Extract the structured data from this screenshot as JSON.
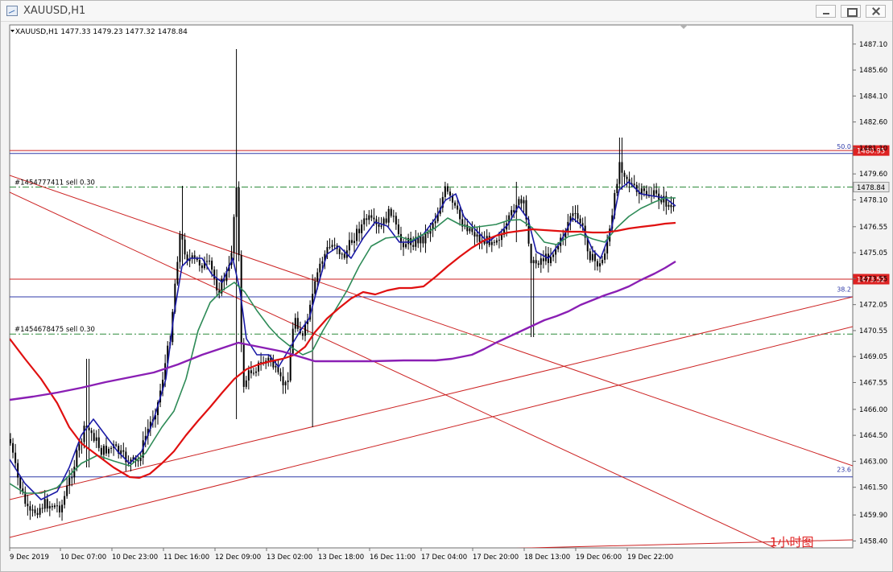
{
  "window": {
    "title": "XAUUSD,H1"
  },
  "chart_header": {
    "symbol_line": "XAUUSD,H1  1477.33 1479.23 1477.32 1478.84"
  },
  "chart_data": {
    "type": "candlestick",
    "symbol": "XAUUSD",
    "timeframe": "H1",
    "ohlc": [
      1477.33,
      1479.23,
      1477.32,
      1478.84
    ],
    "y_ticks": [
      "1487.10",
      "1485.60",
      "1484.10",
      "1482.60",
      "1481.10",
      "1479.60",
      "1478.10",
      "1476.55",
      "1475.05",
      "1473.55",
      "1472.05",
      "1470.55",
      "1469.05",
      "1467.55",
      "1466.00",
      "1464.50",
      "1463.00",
      "1461.50",
      "1459.90",
      "1458.40"
    ],
    "y_tick_values": [
      1487.1,
      1485.6,
      1484.1,
      1482.6,
      1481.1,
      1479.6,
      1478.1,
      1476.55,
      1475.05,
      1473.55,
      1472.05,
      1470.55,
      1469.05,
      1467.55,
      1466.0,
      1464.5,
      1463.0,
      1461.5,
      1459.9,
      1458.4
    ],
    "x_ticks": [
      "9 Dec 2019",
      "10 Dec 07:00",
      "10 Dec 23:00",
      "11 Dec 16:00",
      "12 Dec 09:00",
      "13 Dec 02:00",
      "13 Dec 18:00",
      "16 Dec 11:00",
      "17 Dec 04:00",
      "17 Dec 20:00",
      "18 Dec 13:00",
      "19 Dec 06:00",
      "19 Dec 22:00"
    ],
    "ylim": [
      1458.0,
      1488.2
    ],
    "price_labels": [
      {
        "text": "1480.95",
        "value": 1480.95,
        "bg": "#dd2222"
      },
      {
        "text": "1478.84",
        "value": 1478.84,
        "bg": "#e8e8e8"
      },
      {
        "text": "1473.52",
        "value": 1473.52,
        "bg": "#dd2222"
      }
    ],
    "horizontal_lines": [
      {
        "value": 1480.95,
        "color": "#cc2222",
        "style": "solid"
      },
      {
        "value": 1480.78,
        "color": "#2f3aa8",
        "style": "solid"
      },
      {
        "value": 1478.84,
        "color": "#2c8a3a",
        "style": "dashdot"
      },
      {
        "value": 1473.52,
        "color": "#cc2222",
        "style": "solid"
      },
      {
        "value": 1472.5,
        "color": "#2f3aa8",
        "style": "solid"
      },
      {
        "value": 1470.35,
        "color": "#2c8a3a",
        "style": "dashdot"
      },
      {
        "value": 1462.1,
        "color": "#2f3aa8",
        "style": "solid"
      }
    ],
    "fib_levels": [
      {
        "text": "50.0",
        "value": 1480.95
      },
      {
        "text": "38.2",
        "value": 1472.7
      },
      {
        "text": "23.6",
        "value": 1462.3
      }
    ],
    "order_labels": [
      {
        "text": "#1454777411 sell 0.30",
        "value": 1478.84
      },
      {
        "text": "#1454678475 sell 0.30",
        "value": 1470.35
      }
    ],
    "annotation": "1小时图",
    "colors": {
      "candle": "#000000",
      "ma_fast": "#1a1aa6",
      "ma_mid": "#2e8b57",
      "ma_slow": "#e01010",
      "ma_long": "#8a1fb4",
      "trend": "#cc2222"
    }
  }
}
